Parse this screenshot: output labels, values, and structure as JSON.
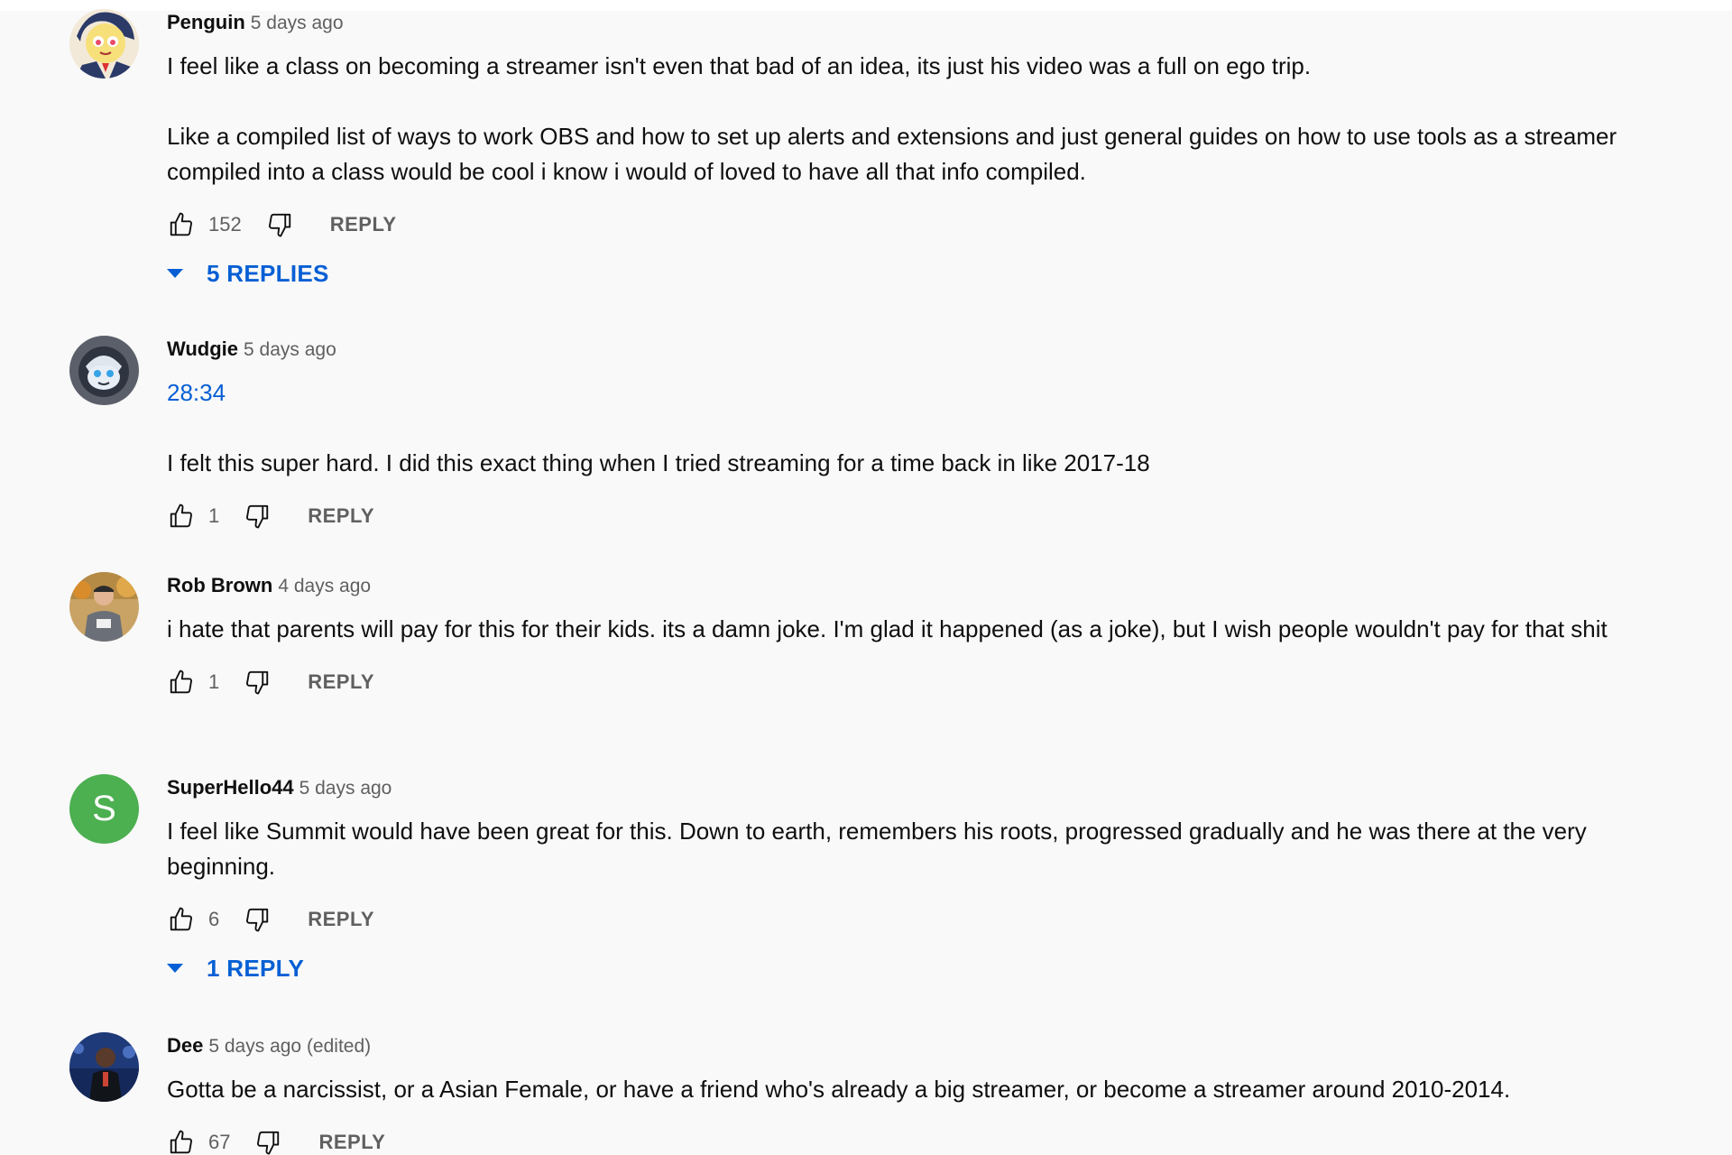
{
  "comments": [
    {
      "author": "Penguin",
      "time": "5 days ago",
      "paragraphs": [
        "I feel like a class on becoming a streamer isn't even that bad of an idea, its just his video was a full on ego trip.",
        "Like a compiled list of ways to work OBS and how to set up alerts and extensions and just general guides on how to use tools as a streamer compiled into a class would be cool i know i would of loved to have all that info compiled."
      ],
      "likes": "152",
      "reply_label": "REPLY",
      "replies_label": "5 REPLIES"
    },
    {
      "author": "Wudgie",
      "time": "5 days ago",
      "timestamp_link": "28:34",
      "paragraphs": [
        "I felt this super hard. I did this exact thing when I tried streaming for a time back in like 2017-18"
      ],
      "likes": "1",
      "reply_label": "REPLY"
    },
    {
      "author": "Rob Brown",
      "time": "4 days ago",
      "paragraphs": [
        "i hate that parents will pay for this for their kids. its a damn joke. I'm glad it happened (as a joke), but I wish people wouldn't pay for that shit"
      ],
      "likes": "1",
      "reply_label": "REPLY"
    },
    {
      "author": "SuperHello44",
      "time": "5 days ago",
      "avatar_letter": "S",
      "paragraphs": [
        "I feel like Summit would have been great for this. Down to earth, remembers his roots, progressed gradually and he was there at the very beginning."
      ],
      "likes": "6",
      "reply_label": "REPLY",
      "replies_label": "1 REPLY"
    },
    {
      "author": "Dee",
      "time": "5 days ago (edited)",
      "paragraphs": [
        "Gotta be a narcissist, or a Asian Female, or have a friend who's already a big streamer, or become a streamer around 2010-2014."
      ],
      "likes": "67",
      "reply_label": "REPLY"
    }
  ],
  "icons": {
    "like": "thumbs-up-icon",
    "dislike": "thumbs-down-icon",
    "expand": "caret-down-icon"
  },
  "colors": {
    "background": "#f9f9f9",
    "link_blue": "#065fd4",
    "secondary_text": "#606060",
    "letter_avatar": "#4caf50"
  }
}
